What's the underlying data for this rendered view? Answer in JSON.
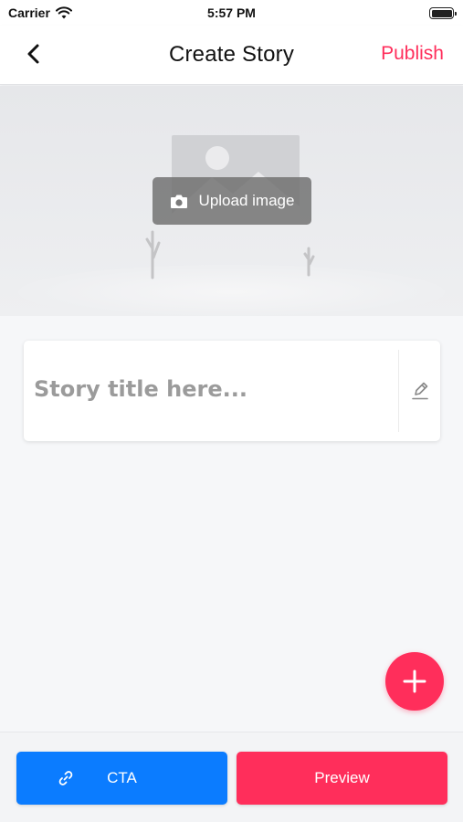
{
  "status_bar": {
    "carrier": "Carrier",
    "time": "5:57 PM",
    "icons": [
      "wifi-icon",
      "battery-icon"
    ]
  },
  "nav": {
    "title": "Create Story",
    "publish_label": "Publish",
    "back_icon": "chevron-left-icon"
  },
  "hero": {
    "upload_label": "Upload image",
    "upload_icon": "camera-icon",
    "placeholder_icon": "image-placeholder-icon"
  },
  "story": {
    "title_placeholder": "Story title here...",
    "title_value": "",
    "edit_icon": "pencil-icon"
  },
  "fab": {
    "icon": "plus-icon"
  },
  "bottom": {
    "cta_label": "CTA",
    "cta_icon": "link-icon",
    "preview_label": "Preview"
  },
  "colors": {
    "accent": "#ff2e5b",
    "primary_blue": "#0b7cff",
    "background": "#f6f7f9"
  }
}
